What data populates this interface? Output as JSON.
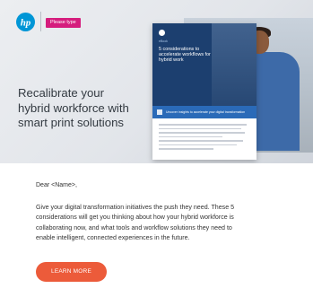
{
  "brand": {
    "logo_text": "hp",
    "tag": "Please type"
  },
  "hero": {
    "headline_lines": [
      "Recalibrate your",
      "hybrid workforce with",
      "smart print solutions"
    ]
  },
  "document": {
    "badge": "eBook",
    "title": "5 considerations to accelerate workflows for hybrid work",
    "band_text": "Uncover insights to accelerate your digital transformation"
  },
  "email": {
    "greeting": "Dear <Name>,",
    "body_lines": [
      "Give your digital transformation initiatives the push they need. These 5",
      "considerations will get you thinking about how your hybrid workforce is",
      "collaborating now, and what tools and workflow solutions they need to",
      "enable intelligent, connected experiences in the future."
    ],
    "cta_label": "LEARN MORE"
  },
  "colors": {
    "hp_blue": "#0096d6",
    "tag_pink": "#d51d7d",
    "cta_orange": "#ec5b3a",
    "doc_navy": "#1c3f6f"
  }
}
